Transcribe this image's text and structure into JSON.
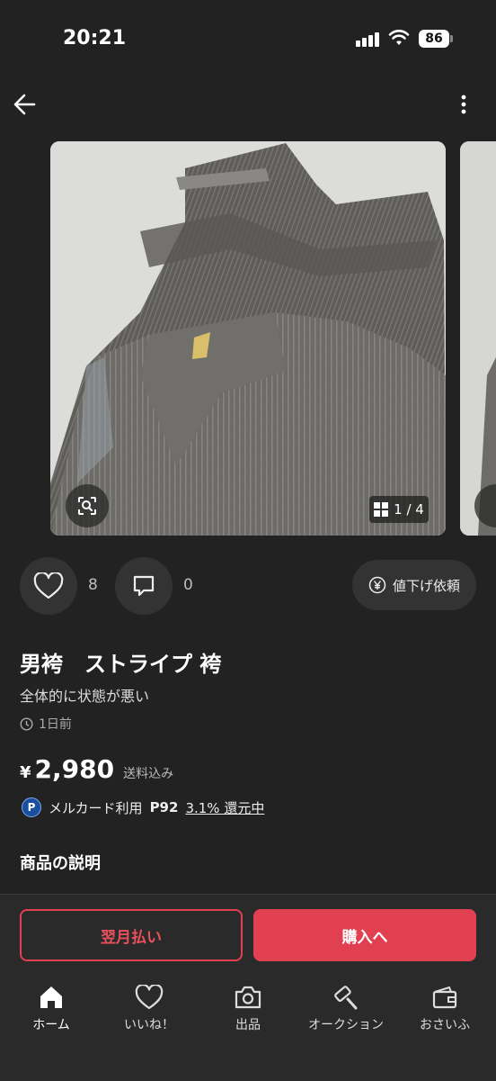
{
  "status_bar": {
    "time": "20:21",
    "battery": "86"
  },
  "gallery": {
    "counter": "1 / 4"
  },
  "actions": {
    "like_count": "8",
    "comment_count": "0",
    "price_request_label": "値下げ依頼"
  },
  "item": {
    "title": "男袴　ストライプ 袴",
    "condition": "全体的に状態が悪い",
    "posted": "1日前",
    "currency": "¥",
    "price": "2,980",
    "shipping": "送料込み",
    "points_badge": "P",
    "points_label": "メルカード利用",
    "points_value": "P92",
    "points_rate": "3.1% 還元中"
  },
  "description_title": "商品の説明",
  "buttons": {
    "pay_later": "翌月払い",
    "buy": "購入へ"
  },
  "tab_bar": [
    {
      "label": "ホーム",
      "icon": "home-icon"
    },
    {
      "label": "いいね！",
      "icon": "heart-icon"
    },
    {
      "label": "出品",
      "icon": "camera-icon"
    },
    {
      "label": "オークション",
      "icon": "gavel-icon"
    },
    {
      "label": "おさいふ",
      "icon": "wallet-icon"
    }
  ],
  "colors": {
    "accent": "#e0404f",
    "background": "#222222",
    "surface": "#333333"
  }
}
